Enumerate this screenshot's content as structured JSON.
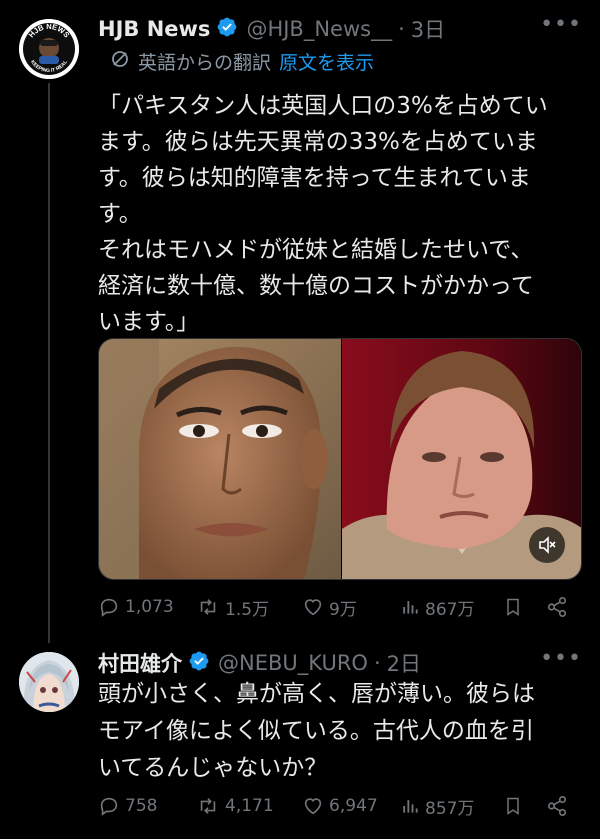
{
  "tweet1": {
    "display_name": "HJB News",
    "handle": "@HJB_News__",
    "separator": "·",
    "time": "3日",
    "avatar_text_top": "HJB NEWS",
    "avatar_text_bottom": "KEEPING IT REAL",
    "translate_label": "英語からの翻訳",
    "translate_link": "原文を表示",
    "body_lines": [
      "「パキスタン人は英国人口の3%を占めてい",
      "ます。彼らは先天異常の33%を占めていま",
      "す。彼らは知的障害を持って生まれていま",
      "す。",
      "それはモハメドが従妹と結婚したせいで、",
      "経済に数十億、数十億のコストがかかって",
      "います。」"
    ],
    "stats": {
      "replies": "1,073",
      "reposts": "1.5万",
      "likes": "9万",
      "views": "867万"
    }
  },
  "tweet2": {
    "display_name": "村田雄介",
    "handle": "@NEBU_KURO",
    "separator": "·",
    "time": "2日",
    "body_lines": [
      "頭が小さく、鼻が高く、唇が薄い。彼らは",
      "モアイ像によく似ている。古代人の血を引",
      "いてるんじゃないか？"
    ],
    "stats": {
      "replies": "758",
      "reposts": "4,171",
      "likes": "6,947",
      "views": "857万"
    }
  },
  "icons": {
    "verified": "verified-badge-icon",
    "translate": "translate-icon",
    "more": "more-icon",
    "reply": "reply-icon",
    "repost": "repost-icon",
    "like": "like-icon",
    "views": "views-icon",
    "bookmark": "bookmark-icon",
    "share": "share-icon",
    "mute": "mute-icon"
  },
  "colors": {
    "background": "#000000",
    "text": "#e7e9ea",
    "muted": "#71767b",
    "link": "#1d9bf0",
    "verified": "#1d9bf0"
  }
}
